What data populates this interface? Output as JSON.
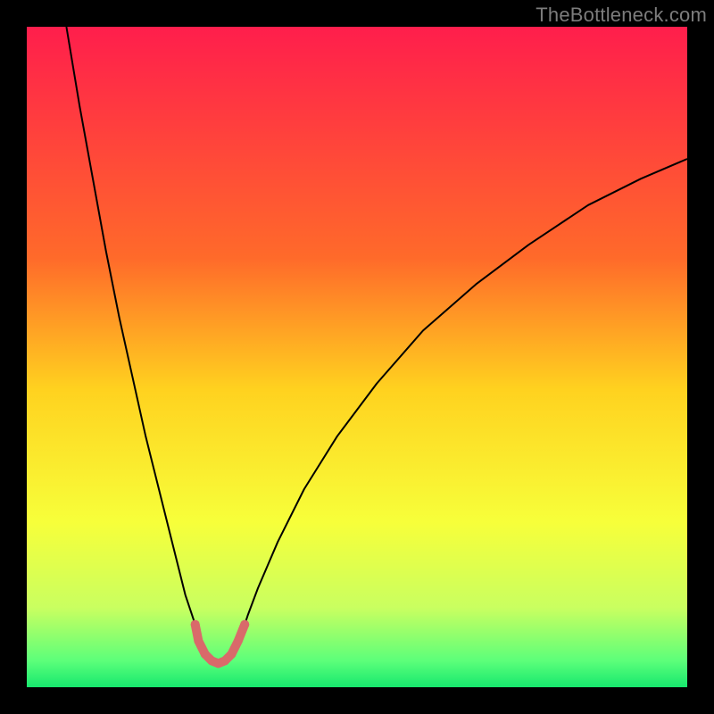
{
  "attribution": "TheBottleneck.com",
  "chart_data": {
    "type": "line",
    "title": "",
    "xlabel": "",
    "ylabel": "",
    "xlim": [
      0,
      100
    ],
    "ylim": [
      0,
      100
    ],
    "gradient_stops": [
      {
        "offset": 0,
        "color": "#ff1e4c"
      },
      {
        "offset": 35,
        "color": "#ff6a2a"
      },
      {
        "offset": 55,
        "color": "#ffd21f"
      },
      {
        "offset": 75,
        "color": "#f7ff3a"
      },
      {
        "offset": 88,
        "color": "#c9ff60"
      },
      {
        "offset": 96,
        "color": "#5cff7a"
      },
      {
        "offset": 100,
        "color": "#17e86e"
      }
    ],
    "series": [
      {
        "name": "left-branch",
        "color": "#000000",
        "width": 2.0,
        "points": [
          {
            "x": 6,
            "y": 100
          },
          {
            "x": 8,
            "y": 88
          },
          {
            "x": 10,
            "y": 77
          },
          {
            "x": 12,
            "y": 66
          },
          {
            "x": 14,
            "y": 56
          },
          {
            "x": 16,
            "y": 47
          },
          {
            "x": 18,
            "y": 38
          },
          {
            "x": 20,
            "y": 30
          },
          {
            "x": 22,
            "y": 22
          },
          {
            "x": 24,
            "y": 14
          },
          {
            "x": 25,
            "y": 11
          },
          {
            "x": 25.5,
            "y": 9.5
          }
        ]
      },
      {
        "name": "right-branch",
        "color": "#000000",
        "width": 2.0,
        "points": [
          {
            "x": 33,
            "y": 9.5
          },
          {
            "x": 33.5,
            "y": 11
          },
          {
            "x": 35,
            "y": 15
          },
          {
            "x": 38,
            "y": 22
          },
          {
            "x": 42,
            "y": 30
          },
          {
            "x": 47,
            "y": 38
          },
          {
            "x": 53,
            "y": 46
          },
          {
            "x": 60,
            "y": 54
          },
          {
            "x": 68,
            "y": 61
          },
          {
            "x": 76,
            "y": 67
          },
          {
            "x": 85,
            "y": 73
          },
          {
            "x": 93,
            "y": 77
          },
          {
            "x": 100,
            "y": 80
          }
        ]
      },
      {
        "name": "valley-highlight",
        "color": "#d96a6a",
        "width": 10,
        "linecap": "round",
        "dots": true,
        "dot_radius": 5,
        "points": [
          {
            "x": 25.5,
            "y": 9.5
          },
          {
            "x": 26,
            "y": 7
          },
          {
            "x": 27,
            "y": 5
          },
          {
            "x": 28,
            "y": 4
          },
          {
            "x": 29,
            "y": 3.6
          },
          {
            "x": 30,
            "y": 4
          },
          {
            "x": 31,
            "y": 5
          },
          {
            "x": 32,
            "y": 7
          },
          {
            "x": 33,
            "y": 9.5
          }
        ]
      }
    ]
  }
}
